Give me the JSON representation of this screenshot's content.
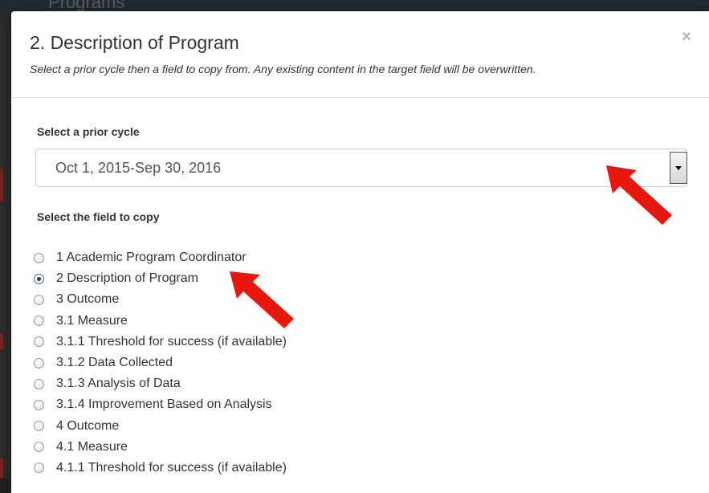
{
  "backdrop": {
    "ghost_text": "Programs"
  },
  "modal": {
    "title": "2. Description of Program",
    "subtitle": "Select a prior cycle then a field to copy from. Any existing content in the target field will be overwritten.",
    "close_glyph": "×"
  },
  "cycle": {
    "label": "Select a prior cycle",
    "selected": "Oct 1, 2015-Sep 30, 2016"
  },
  "fields": {
    "label": "Select the field to copy",
    "selected_index": 1,
    "items": [
      "1 Academic Program Coordinator",
      "2 Description of Program",
      "3 Outcome",
      "3.1 Measure",
      "3.1.1 Threshold for success (if available)",
      "3.1.2 Data Collected",
      "3.1.3 Analysis of Data",
      "3.1.4 Improvement Based on Analysis",
      "4 Outcome",
      "4.1 Measure",
      "4.1.1 Threshold for success (if available)"
    ]
  },
  "annotation": {
    "arrow_color": "#e8180f",
    "arrow_icons": [
      "red-arrow-icon",
      "red-arrow-icon"
    ]
  }
}
